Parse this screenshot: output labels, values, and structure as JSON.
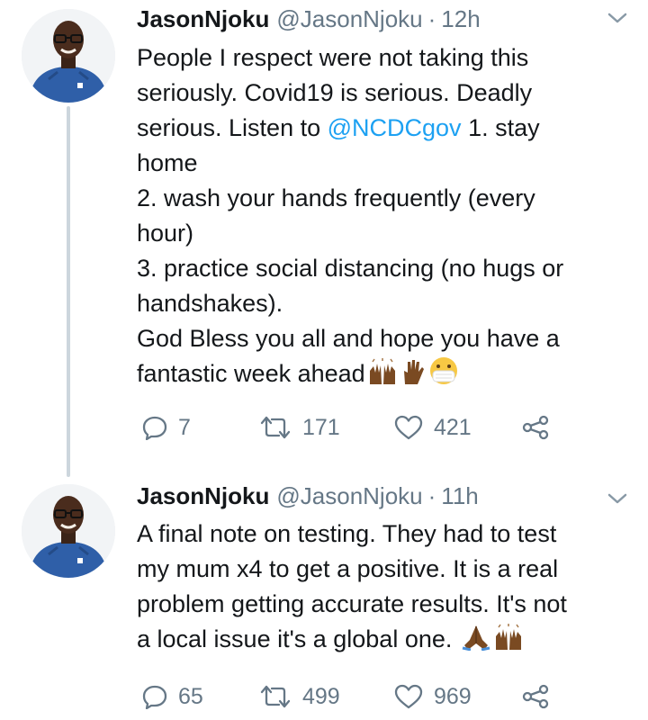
{
  "tweets": [
    {
      "display_name": "JasonNjoku",
      "handle": "@JasonNjoku",
      "separator": "·",
      "time": "12h",
      "body_lines": [
        {
          "pre": "People I respect were not taking this"
        },
        {
          "pre": "seriously. Covid19 is serious. Deadly"
        },
        {
          "pre": "serious. Listen to ",
          "mention": "@NCDCgov",
          "post": " 1. stay"
        },
        {
          "pre": "home"
        },
        {
          "pre": "2. wash your hands frequently (every"
        },
        {
          "pre": "hour)"
        },
        {
          "pre": "3. practice social distancing (no hugs or"
        },
        {
          "pre": "handshakes)."
        },
        {
          "pre": "God Bless you all and hope you have a"
        },
        {
          "pre": "fantastic week ahead"
        }
      ],
      "emojis": [
        "raising-hands-emoji",
        "raised-hand-emoji",
        "face-with-medical-mask-emoji"
      ],
      "replies": "7",
      "retweets": "171",
      "likes": "421"
    },
    {
      "display_name": "JasonNjoku",
      "handle": "@JasonNjoku",
      "separator": "·",
      "time": "11h",
      "body_lines": [
        {
          "pre": "A final note on testing. They had to test"
        },
        {
          "pre": "my mum x4 to get a positive. It is a real"
        },
        {
          "pre": "problem getting accurate results. It's not"
        },
        {
          "pre": "a local issue it's a global one. "
        }
      ],
      "emojis": [
        "folded-hands-emoji",
        "raising-hands-emoji"
      ],
      "replies": "65",
      "retweets": "499",
      "likes": "969"
    }
  ],
  "colors": {
    "text": "#14171a",
    "secondary": "#657786",
    "link": "#1da1f2",
    "thread_line": "#ccd6dd",
    "shirt": "#2f5fa8"
  },
  "icons": {
    "reply": "reply-icon",
    "retweet": "retweet-icon",
    "like": "heart-icon",
    "share": "share-icon",
    "menu": "chevron-down-icon"
  }
}
